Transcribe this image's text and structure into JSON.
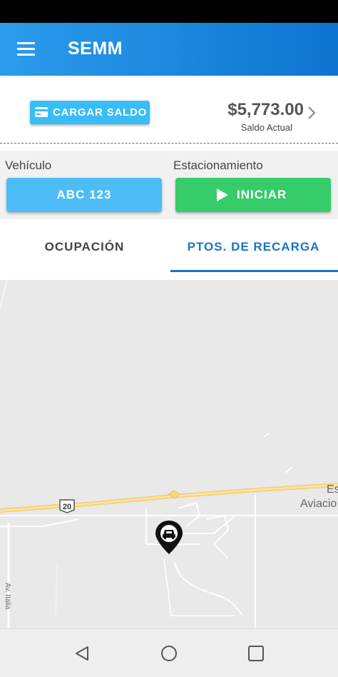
{
  "app": {
    "title": "SEMM"
  },
  "balance": {
    "cargar_label": "CARGAR SALDO",
    "amount": "$5,773.00",
    "label": "Saldo Actual"
  },
  "vehicle_section": {
    "vehicle_label": "Vehículo",
    "vehicle_plate": "ABC 123",
    "parking_label": "Estacionamiento",
    "start_label": "INICIAR"
  },
  "tabs": [
    {
      "label": "OCUPACIÓN",
      "active": false
    },
    {
      "label": "PTOS. DE RECARGA",
      "active": true
    }
  ],
  "map": {
    "route_shield": "20",
    "place_label_1": "Es",
    "place_label_2": "Aviacio",
    "street_label": "Av. Italia",
    "marker_icon": "car-pin-icon"
  },
  "colors": {
    "app_bar": "#1a86e0",
    "cargar_button": "#39bdf6",
    "vehicle_button": "#4dbdf7",
    "start_button": "#36cc6a",
    "active_tab": "#1a74c4"
  }
}
